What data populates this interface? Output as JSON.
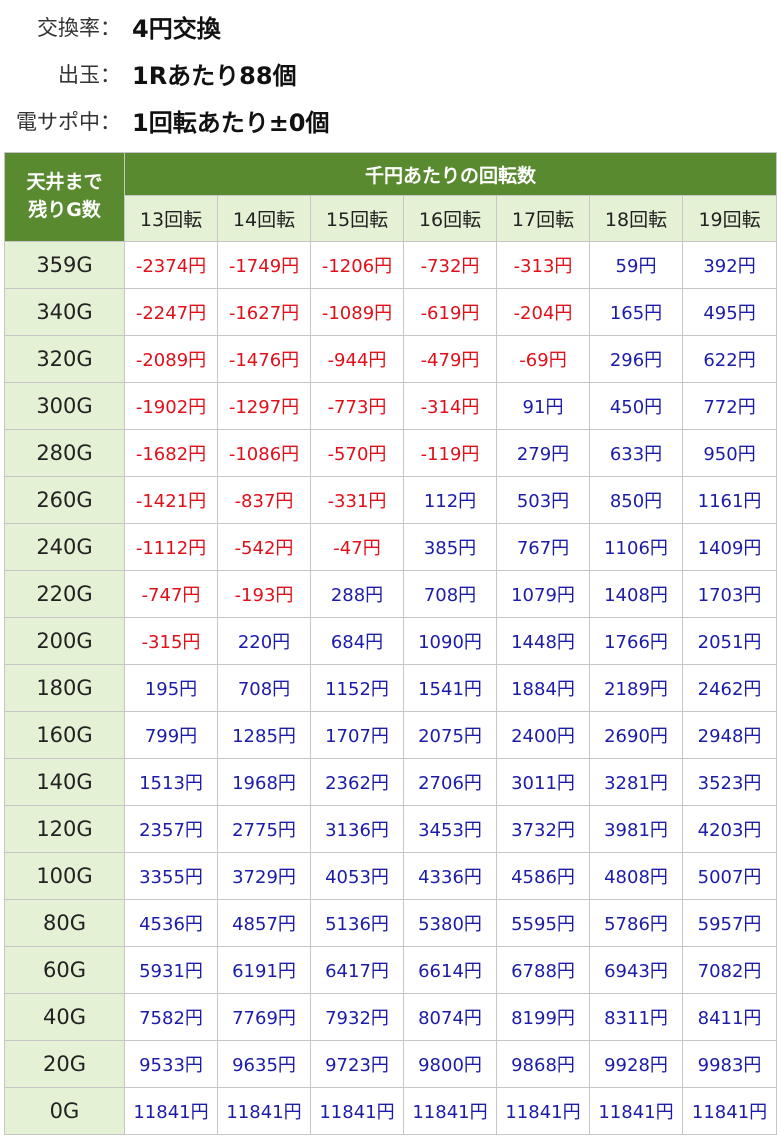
{
  "info": [
    {
      "label": "交換率：",
      "value": "4円交換"
    },
    {
      "label": "出玉：",
      "value": "1Rあたり88個"
    },
    {
      "label": "電サポ中：",
      "value": "1回転あたり±0個"
    }
  ],
  "table": {
    "corner_label": [
      "天井まで",
      "残りG数"
    ],
    "group_header": "千円あたりの回転数",
    "columns": [
      "13回転",
      "14回転",
      "15回転",
      "16回転",
      "17回転",
      "18回転",
      "19回転"
    ],
    "colors": {
      "header_bg": "#5a8a2f",
      "subheader_bg": "#e5f1d5",
      "negative": "#e0101a",
      "positive": "#1c1ca8"
    },
    "rows": [
      {
        "label": "359G",
        "cells": [
          "-2374円",
          "-1749円",
          "-1206円",
          "-732円",
          "-313円",
          "59円",
          "392円"
        ]
      },
      {
        "label": "340G",
        "cells": [
          "-2247円",
          "-1627円",
          "-1089円",
          "-619円",
          "-204円",
          "165円",
          "495円"
        ]
      },
      {
        "label": "320G",
        "cells": [
          "-2089円",
          "-1476円",
          "-944円",
          "-479円",
          "-69円",
          "296円",
          "622円"
        ]
      },
      {
        "label": "300G",
        "cells": [
          "-1902円",
          "-1297円",
          "-773円",
          "-314円",
          "91円",
          "450円",
          "772円"
        ]
      },
      {
        "label": "280G",
        "cells": [
          "-1682円",
          "-1086円",
          "-570円",
          "-119円",
          "279円",
          "633円",
          "950円"
        ]
      },
      {
        "label": "260G",
        "cells": [
          "-1421円",
          "-837円",
          "-331円",
          "112円",
          "503円",
          "850円",
          "1161円"
        ]
      },
      {
        "label": "240G",
        "cells": [
          "-1112円",
          "-542円",
          "-47円",
          "385円",
          "767円",
          "1106円",
          "1409円"
        ]
      },
      {
        "label": "220G",
        "cells": [
          "-747円",
          "-193円",
          "288円",
          "708円",
          "1079円",
          "1408円",
          "1703円"
        ]
      },
      {
        "label": "200G",
        "cells": [
          "-315円",
          "220円",
          "684円",
          "1090円",
          "1448円",
          "1766円",
          "2051円"
        ]
      },
      {
        "label": "180G",
        "cells": [
          "195円",
          "708円",
          "1152円",
          "1541円",
          "1884円",
          "2189円",
          "2462円"
        ]
      },
      {
        "label": "160G",
        "cells": [
          "799円",
          "1285円",
          "1707円",
          "2075円",
          "2400円",
          "2690円",
          "2948円"
        ]
      },
      {
        "label": "140G",
        "cells": [
          "1513円",
          "1968円",
          "2362円",
          "2706円",
          "3011円",
          "3281円",
          "3523円"
        ]
      },
      {
        "label": "120G",
        "cells": [
          "2357円",
          "2775円",
          "3136円",
          "3453円",
          "3732円",
          "3981円",
          "4203円"
        ]
      },
      {
        "label": "100G",
        "cells": [
          "3355円",
          "3729円",
          "4053円",
          "4336円",
          "4586円",
          "4808円",
          "5007円"
        ]
      },
      {
        "label": "80G",
        "cells": [
          "4536円",
          "4857円",
          "5136円",
          "5380円",
          "5595円",
          "5786円",
          "5957円"
        ]
      },
      {
        "label": "60G",
        "cells": [
          "5931円",
          "6191円",
          "6417円",
          "6614円",
          "6788円",
          "6943円",
          "7082円"
        ]
      },
      {
        "label": "40G",
        "cells": [
          "7582円",
          "7769円",
          "7932円",
          "8074円",
          "8199円",
          "8311円",
          "8411円"
        ]
      },
      {
        "label": "20G",
        "cells": [
          "9533円",
          "9635円",
          "9723円",
          "9800円",
          "9868円",
          "9928円",
          "9983円"
        ]
      },
      {
        "label": "0G",
        "cells": [
          "11841円",
          "11841円",
          "11841円",
          "11841円",
          "11841円",
          "11841円",
          "11841円"
        ]
      }
    ]
  }
}
